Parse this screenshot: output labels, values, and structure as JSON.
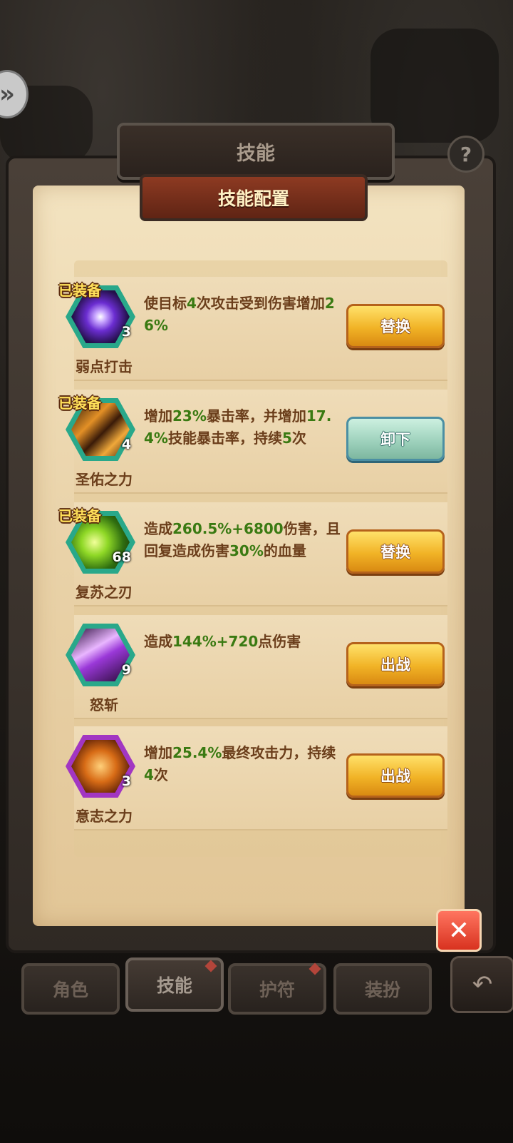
{
  "header": {
    "title": "技能",
    "help_icon": "question-icon"
  },
  "panel": {
    "subtitle": "技能配置"
  },
  "skills": [
    {
      "name": "弱点打击",
      "level": "3",
      "equipped": true,
      "equipped_label": "已装备",
      "desc_parts": [
        [
          "使目标",
          ""
        ],
        [
          "4",
          "g"
        ],
        [
          "次攻击受到伤害增加",
          ""
        ],
        [
          "26%",
          "g"
        ]
      ],
      "button": "替换",
      "button_style": "yellow",
      "icon": "purple-eye-icon",
      "hex_color": "#29a88a"
    },
    {
      "name": "圣佑之力",
      "level": "4",
      "equipped": true,
      "equipped_label": "已装备",
      "desc_parts": [
        [
          "增加",
          ""
        ],
        [
          "23%",
          "g"
        ],
        [
          "暴击率，并增加",
          ""
        ],
        [
          "17.4%",
          "g"
        ],
        [
          "技能暴击率，持续",
          ""
        ],
        [
          "5",
          "g"
        ],
        [
          "次",
          ""
        ]
      ],
      "button": "卸下",
      "button_style": "teal",
      "icon": "holy-sword-icon",
      "hex_color": "#29a88a"
    },
    {
      "name": "复苏之刃",
      "level": "68",
      "equipped": true,
      "equipped_label": "已装备",
      "desc_parts": [
        [
          "造成",
          ""
        ],
        [
          "260.5%+6800",
          "g"
        ],
        [
          "伤害，且回复造成伤害",
          ""
        ],
        [
          "30%",
          "g"
        ],
        [
          "的血量",
          ""
        ]
      ],
      "button": "替换",
      "button_style": "yellow",
      "icon": "green-blade-icon",
      "hex_color": "#29a88a"
    },
    {
      "name": "怒斩",
      "level": "9",
      "equipped": false,
      "equipped_label": "",
      "desc_parts": [
        [
          "造成",
          ""
        ],
        [
          "144%+720",
          "g"
        ],
        [
          "点伤害",
          ""
        ]
      ],
      "button": "出战",
      "button_style": "yellow",
      "icon": "purple-slash-icon",
      "hex_color": "#29a88a"
    },
    {
      "name": "意志之力",
      "level": "3",
      "equipped": false,
      "equipped_label": "",
      "desc_parts": [
        [
          "增加",
          ""
        ],
        [
          "25.4%",
          "g"
        ],
        [
          "最终攻击力，持续",
          ""
        ],
        [
          "4",
          "g"
        ],
        [
          "次",
          ""
        ]
      ],
      "button": "出战",
      "button_style": "yellow",
      "icon": "fist-icon",
      "hex_color": "#a236c2"
    }
  ],
  "close_icon": "close-icon",
  "tabs": [
    {
      "label": "角色",
      "active": false
    },
    {
      "label": "技能",
      "active": true
    },
    {
      "label": "护符",
      "active": false
    },
    {
      "label": "装扮",
      "active": false
    }
  ],
  "back_icon": "back-arrow-icon"
}
